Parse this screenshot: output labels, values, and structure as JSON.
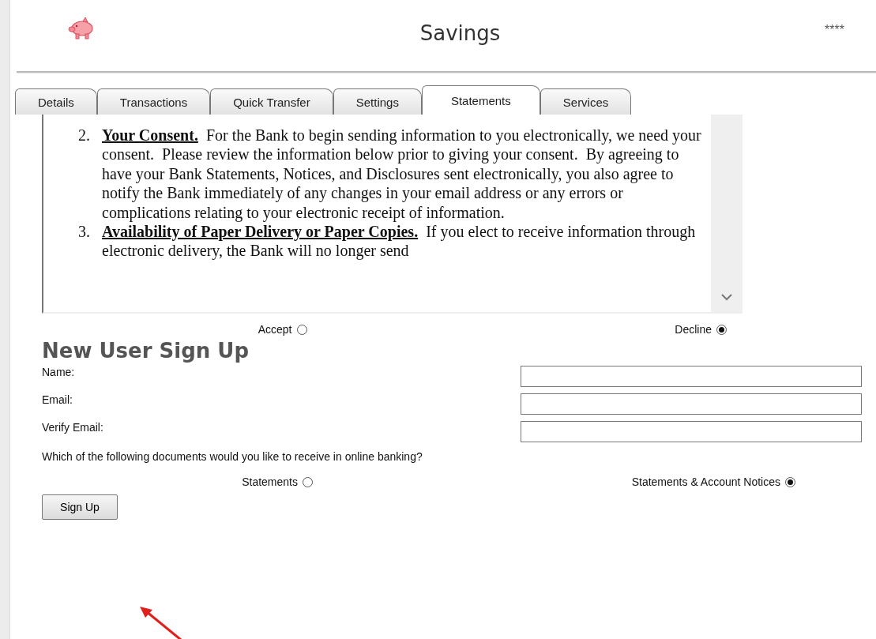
{
  "header": {
    "title": "Savings",
    "account_mask": "****"
  },
  "tabs": [
    {
      "label": "Details",
      "selected": false
    },
    {
      "label": "Transactions",
      "selected": false
    },
    {
      "label": "Quick Transfer",
      "selected": false
    },
    {
      "label": "Settings",
      "selected": false
    },
    {
      "label": "Statements",
      "selected": true
    },
    {
      "label": "Services",
      "selected": false
    }
  ],
  "agreement": {
    "items": [
      {
        "number": "2.",
        "text": "**Your Consent.**  For the Bank to begin sending information to you electronically, we need your consent.  Please review the information below prior to giving your consent.  By agreeing to have your Bank Statements, Notices, and Disclosures sent electronically, you also agree to notify the Bank immediately of any changes in your email address or any errors or complications relating to your electronic receipt of information."
      },
      {
        "number": "3.",
        "text": "**Availability of Paper Delivery or Paper Copies.**  If you elect to receive information through electronic delivery, the Bank will no longer send"
      }
    ]
  },
  "consent_options": [
    {
      "label": "Accept",
      "selected": false
    },
    {
      "label": "Decline",
      "selected": true
    }
  ],
  "signup": {
    "title": "New User Sign Up",
    "fields": [
      {
        "label": "Name:"
      },
      {
        "label": "Email:"
      },
      {
        "label": "Verify Email:"
      }
    ],
    "question": "Which of the following documents would you like to receive in online banking?",
    "document_options": [
      {
        "label": "Statements",
        "selected": false
      },
      {
        "label": "Statements & Account Notices",
        "selected": true
      }
    ],
    "button": "Sign Up"
  }
}
